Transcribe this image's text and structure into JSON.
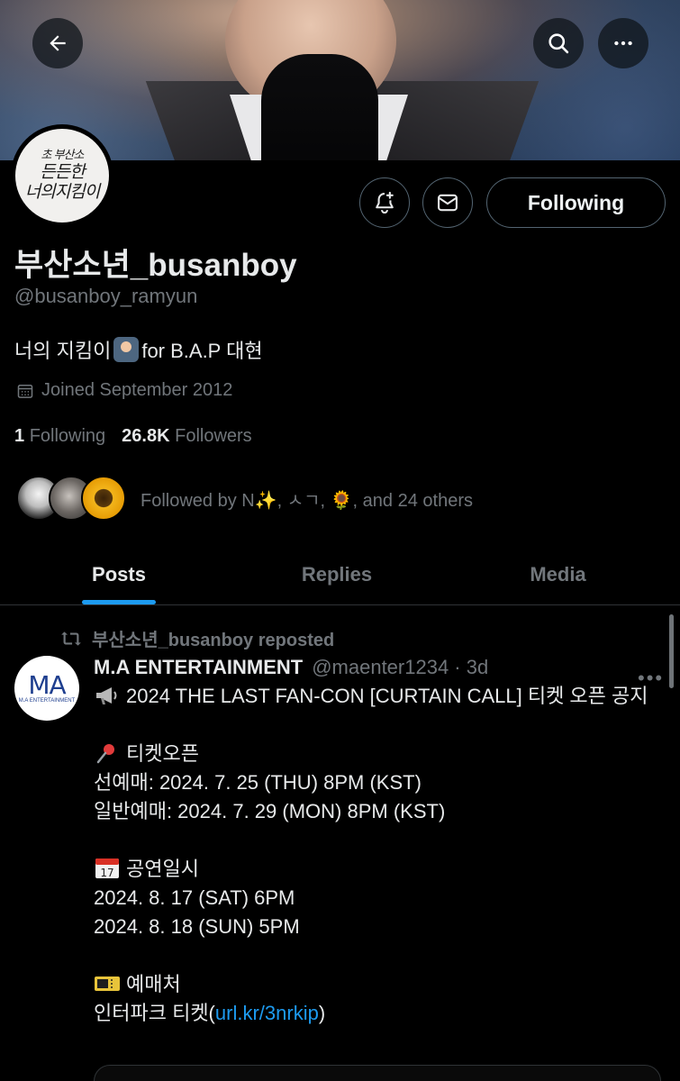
{
  "banner": {
    "back_icon": "arrow-left-icon",
    "search_icon": "search-icon",
    "more_icon": "more-horizontal-icon"
  },
  "avatar": {
    "lines": [
      "초 부산소",
      "든든한",
      "너의지킴이"
    ]
  },
  "actions": {
    "notify_icon": "bell-plus-icon",
    "message_icon": "mail-icon",
    "follow_label": "Following"
  },
  "profile": {
    "display_name": "부산소년_busanboy",
    "handle": "@busanboy_ramyun",
    "bio_prefix": "너의 지킴이",
    "bio_suffix": "for B.A.P 대현",
    "joined": "Joined September 2012",
    "following_count": "1",
    "following_label": "Following",
    "followers_count": "26.8K",
    "followers_label": "Followers",
    "followed_by": "Followed by N✨, ㅅㄱ, 🌻, and 24 others"
  },
  "tabs": [
    {
      "label": "Posts"
    },
    {
      "label": "Replies"
    },
    {
      "label": "Media"
    }
  ],
  "post": {
    "repost_label": "부산소년_busanboy reposted",
    "author": "M.A ENTERTAINMENT",
    "author_handle": "@maenter1234",
    "time": "3d",
    "avatar_text": "MA",
    "avatar_subtext": "M.A ENTERTAINMENT",
    "line1": "2024 THE LAST FAN-CON [CURTAIN CALL] 티켓 오픈 공지",
    "section1_title": "티켓오픈",
    "section1_l1": "선예매: 2024. 7. 25 (THU) 8PM (KST)",
    "section1_l2": "일반예매: 2024. 7. 29 (MON) 8PM (KST)",
    "section2_title": "공연일시",
    "section2_l1": "2024. 8. 17 (SAT) 6PM",
    "section2_l2": "2024. 8. 18 (SUN) 5PM",
    "section3_title": "예매처",
    "section3_prefix": "인터파크 티켓(",
    "section3_link": "url.kr/3nrkip",
    "section3_suffix": ")"
  },
  "colors": {
    "accent": "#1d9bf0",
    "muted": "#71767b",
    "border": "#2f3336"
  }
}
